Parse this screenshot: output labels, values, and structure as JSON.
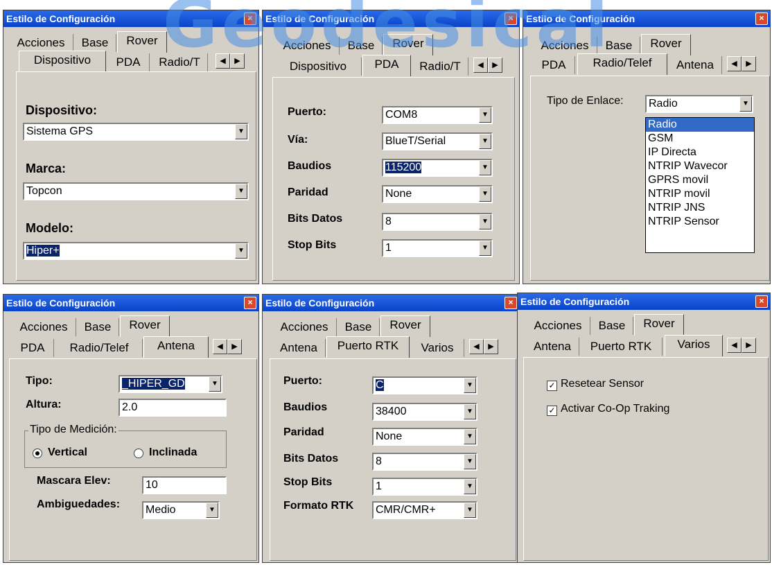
{
  "watermark": "Geodesical",
  "window_title": "Estilo de Configuración",
  "close_glyph": "×",
  "main_tabs": [
    "Acciones",
    "Base",
    "Rover"
  ],
  "arrows": {
    "left": "◀",
    "right": "▶"
  },
  "dd_glyph": "▼",
  "check_glyph": "✓",
  "w1": {
    "subtabs": [
      "Dispositivo",
      "PDA",
      "Radio/T"
    ],
    "dispositivo_label": "Dispositivo:",
    "dispositivo_value": "Sistema GPS",
    "marca_label": "Marca:",
    "marca_value": "Topcon",
    "modelo_label": "Modelo:",
    "modelo_value": "Hiper+"
  },
  "w2": {
    "subtabs": [
      "Dispositivo",
      "PDA",
      "Radio/T"
    ],
    "rows": [
      {
        "label": "Puerto:",
        "value": "COM8"
      },
      {
        "label": "Vía:",
        "value": "BlueT/Serial"
      },
      {
        "label": "Baudios",
        "value": "115200"
      },
      {
        "label": "Paridad",
        "value": "None"
      },
      {
        "label": "Bits Datos",
        "value": "8"
      },
      {
        "label": "Stop Bits",
        "value": "1"
      }
    ]
  },
  "w3": {
    "subtabs": [
      "PDA",
      "Radio/Telef",
      "Antena"
    ],
    "enlace_label": "Tipo de Enlace:",
    "enlace_value": "Radio",
    "options": [
      "Radio",
      "GSM",
      "IP Directa",
      "NTRIP Wavecor",
      "GPRS movil",
      "NTRIP movil",
      "NTRIP JNS",
      "NTRIP Sensor"
    ]
  },
  "w4": {
    "subtabs": [
      "PDA",
      "Radio/Telef",
      "Antena"
    ],
    "tipo_label": "Tipo:",
    "tipo_value": "_HIPER_GD",
    "altura_label": "Altura:",
    "altura_value": "2.0",
    "medicion_label": "Tipo de Medición:",
    "vertical_label": "Vertical",
    "inclinada_label": "Inclinada",
    "mascara_label": "Mascara Elev:",
    "mascara_value": "10",
    "ambig_label": "Ambiguedades:",
    "ambig_value": "Medio"
  },
  "w5": {
    "subtabs": [
      "Antena",
      "Puerto RTK",
      "Varios"
    ],
    "rows": [
      {
        "label": "Puerto:",
        "value": "C"
      },
      {
        "label": "Baudios",
        "value": "38400"
      },
      {
        "label": "Paridad",
        "value": "None"
      },
      {
        "label": "Bits Datos",
        "value": "8"
      },
      {
        "label": "Stop Bits",
        "value": "1"
      },
      {
        "label": "Formato RTK",
        "value": "CMR/CMR+"
      }
    ]
  },
  "w6": {
    "subtabs": [
      "Antena",
      "Puerto RTK",
      "Varios"
    ],
    "reset_label": "Resetear Sensor",
    "coop_label": "Activar Co-Op Traking"
  }
}
